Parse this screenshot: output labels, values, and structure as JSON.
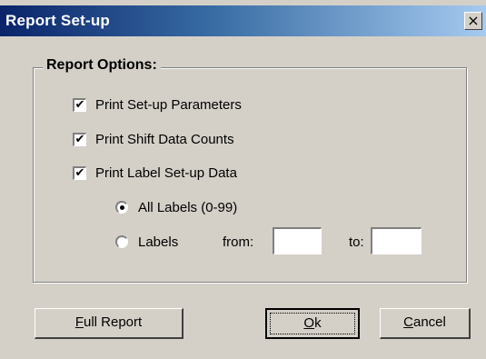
{
  "dialog": {
    "title": "Report Set-up",
    "close_label": "×"
  },
  "group": {
    "legend": "Report Options:"
  },
  "options": [
    {
      "label": "Print Set-up Parameters",
      "checked": true
    },
    {
      "label": "Print Shift Data Counts",
      "checked": true
    },
    {
      "label": "Print Label Set-up Data",
      "checked": true
    }
  ],
  "range": {
    "all_label": "All Labels (0-99)",
    "all_selected": true,
    "labels_label": "Labels",
    "labels_selected": false,
    "from_label": "from:",
    "to_label": "to:",
    "from_value": "",
    "to_value": ""
  },
  "buttons": {
    "full_report": {
      "mnemonic": "F",
      "rest": "ull Report"
    },
    "ok": {
      "mnemonic": "O",
      "rest": "k"
    },
    "cancel": {
      "mnemonic": "C",
      "rest": "ancel"
    }
  },
  "glyphs": {
    "check": "✔"
  }
}
